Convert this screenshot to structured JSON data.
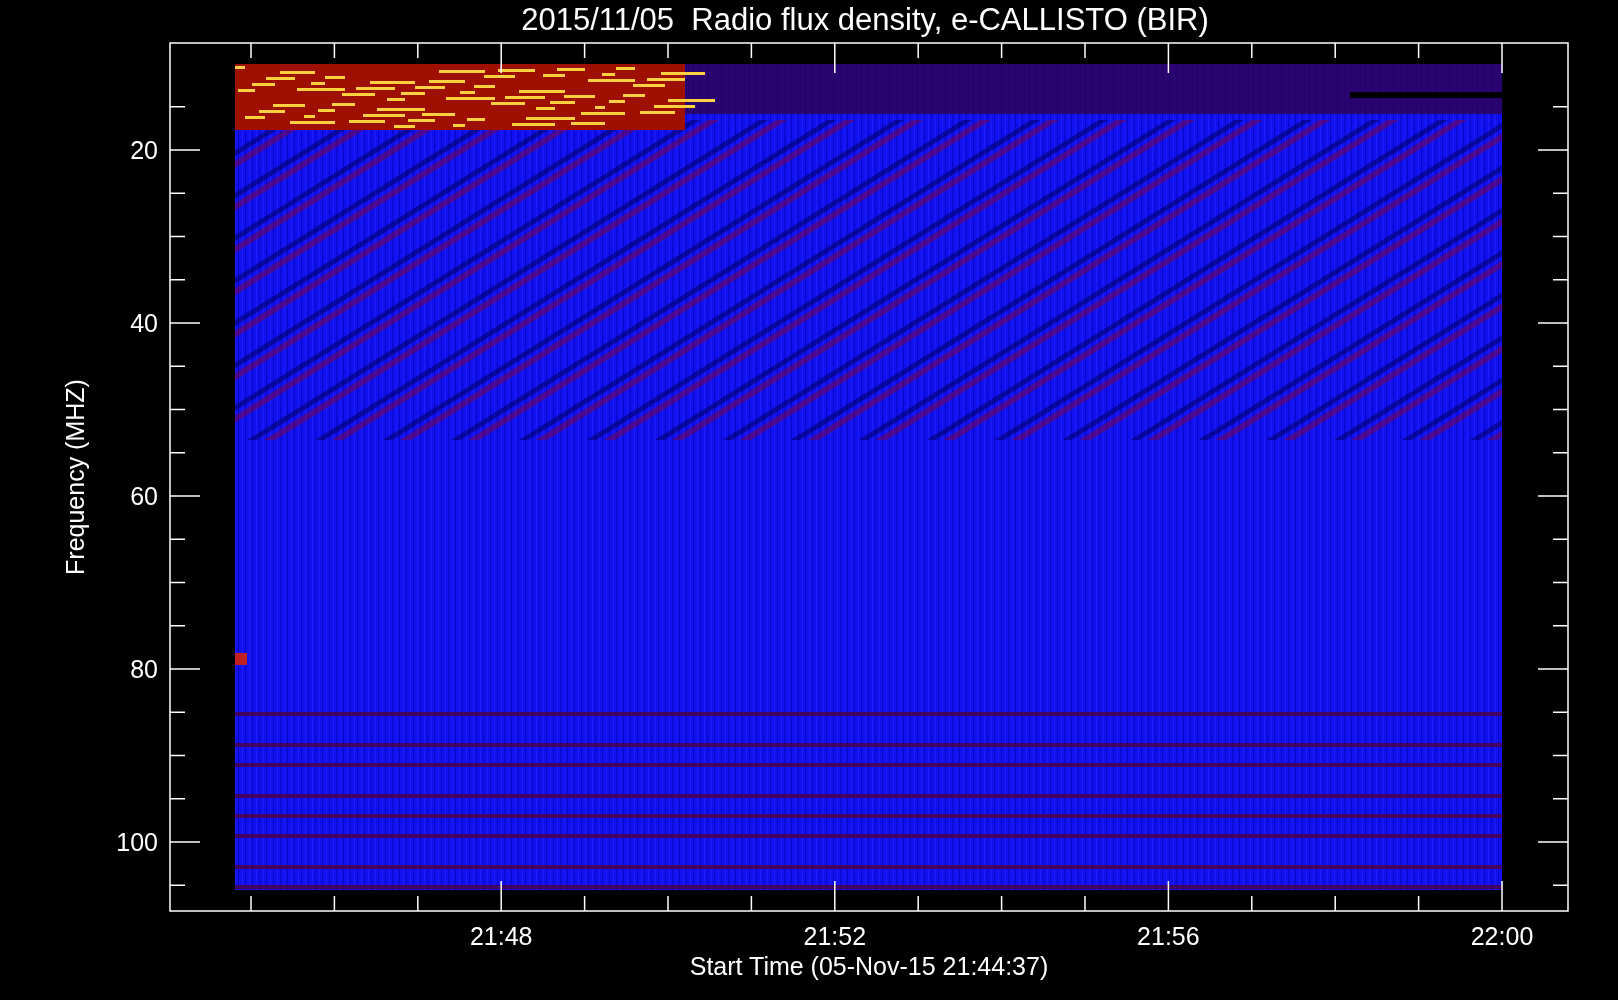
{
  "title": "2015/11/05  Radio flux density, e-CALLISTO (BIR)",
  "y_axis": {
    "label": "Frequency (MHZ)",
    "ticks": [
      "20",
      "40",
      "60",
      "80",
      "100"
    ]
  },
  "x_axis": {
    "label": "Start Time (05-Nov-15 21:44:37)",
    "ticks": [
      "21:48",
      "21:52",
      "21:56",
      "22:00"
    ]
  }
}
